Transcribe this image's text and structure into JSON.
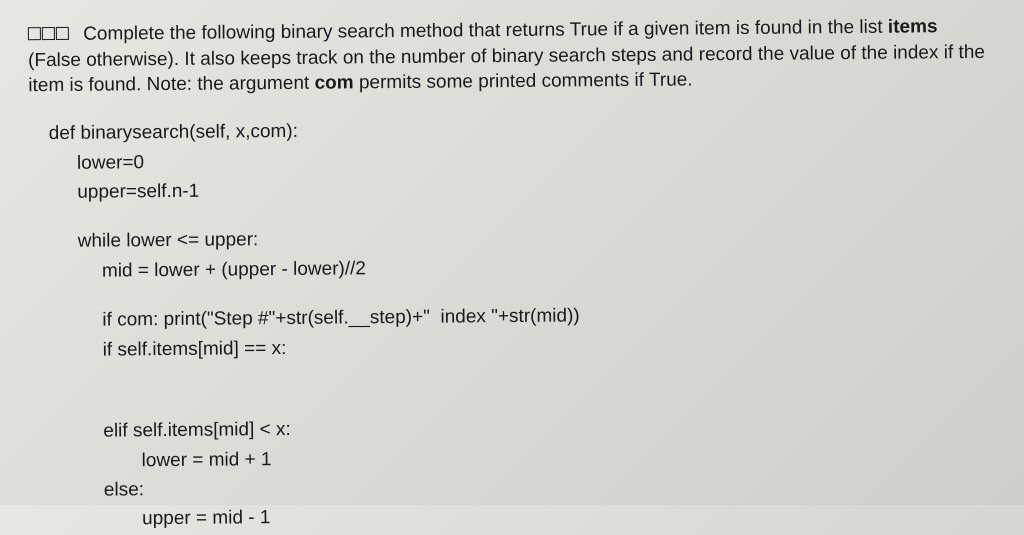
{
  "prompt": {
    "line1_pre": " Complete the following binary search method that returns True if a given item is found in the list ",
    "items_word": "items",
    "line1_mid": " (False otherwise). It also keeps track on the number of binary search steps and record the value of the index if the item is found. Note: the argument ",
    "com_word": "com",
    "line1_end": " permits some printed comments if True."
  },
  "code": {
    "l1": "def binarysearch(self, x,com):",
    "l2": "lower=0",
    "l3": "upper=self.n-1",
    "l4": "while lower <= upper:",
    "l5": "mid = lower + (upper - lower)//2",
    "l6": "if com: print(\"Step #\"+str(self.__step)+\"  index \"+str(mid))",
    "l7": "if self.items[mid] == x:",
    "l8": "elif self.items[mid] < x:",
    "l9": "lower = mid + 1",
    "l10": "else:",
    "l11": "upper = mid - 1"
  }
}
